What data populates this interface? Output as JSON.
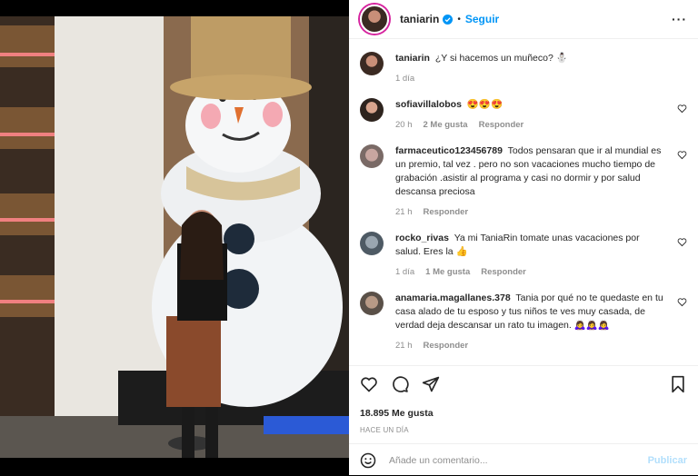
{
  "post": {
    "author": "taniarin",
    "follow_label": "Seguir",
    "caption_text": "¿Y si hacemos un muñeco? ⛄",
    "caption_time": "1 día"
  },
  "comments": [
    {
      "user": "sofiavillalobos",
      "text": "😍😍😍",
      "time": "20 h",
      "likes": "2 Me gusta",
      "reply": "Responder"
    },
    {
      "user": "farmaceutico123456789",
      "text": "Todos pensaran que ir al mundial es un premio, tal vez . pero no son vacaciones mucho tiempo de grabación .asistir al programa y casi no dormir y por salud descansa preciosa",
      "time": "21 h",
      "likes": "",
      "reply": "Responder"
    },
    {
      "user": "rocko_rivas",
      "text": "Ya mi TaniaRin tomate unas vacaciones por salud. Eres la 👍",
      "time": "1 día",
      "likes": "1 Me gusta",
      "reply": "Responder"
    },
    {
      "user": "anamaria.magallanes.378",
      "text": "Tania por qué no te quedaste en tu casa alado de tu esposo y tus niños te ves muy casada, de verdad deja descansar un rato tu imagen. 🙇‍♀️🙇‍♀️🙇‍♀️",
      "time": "21 h",
      "likes": "",
      "reply": "Responder"
    }
  ],
  "stats": {
    "likes": "18.895 Me gusta",
    "posted": "HACE UN DÍA"
  },
  "add_comment": {
    "placeholder": "Añade un comentario...",
    "publish": "Publicar"
  },
  "colors": {
    "accent": "#0095f6",
    "muted": "#8e8e8e",
    "publish_disabled": "#b2dffc"
  }
}
